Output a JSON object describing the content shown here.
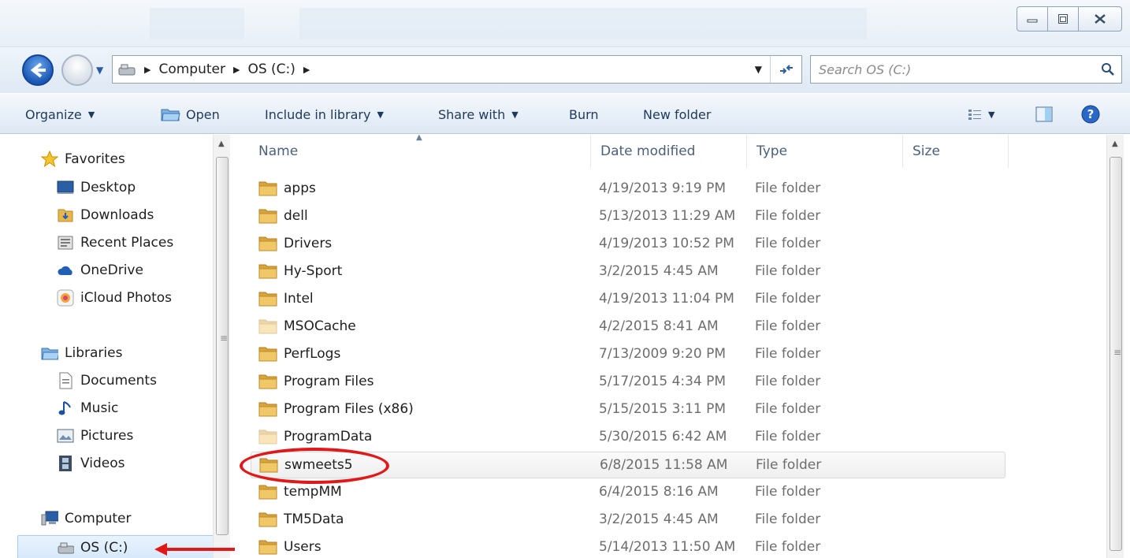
{
  "window": {
    "minimize_label": "",
    "maximize_label": "",
    "close_label": ""
  },
  "address": {
    "crumbs": [
      "Computer",
      "OS (C:)"
    ]
  },
  "search": {
    "placeholder": "Search OS (C:)"
  },
  "toolbar": {
    "organize": "Organize",
    "open": "Open",
    "include_in_library": "Include in library",
    "share_with": "Share with",
    "burn": "Burn",
    "new_folder": "New folder"
  },
  "nav": {
    "favorites": "Favorites",
    "desktop": "Desktop",
    "downloads": "Downloads",
    "recent_places": "Recent Places",
    "onedrive": "OneDrive",
    "icloud_photos": "iCloud Photos",
    "libraries": "Libraries",
    "documents": "Documents",
    "music": "Music",
    "pictures": "Pictures",
    "videos": "Videos",
    "computer": "Computer",
    "os_c": "OS (C:)"
  },
  "columns": {
    "name": "Name",
    "date_modified": "Date modified",
    "type": "Type",
    "size": "Size"
  },
  "files": [
    {
      "name": "apps",
      "date": "4/19/2013 9:19 PM",
      "type": "File folder"
    },
    {
      "name": "dell",
      "date": "5/13/2013 11:29 AM",
      "type": "File folder"
    },
    {
      "name": "Drivers",
      "date": "4/19/2013 10:52 PM",
      "type": "File folder"
    },
    {
      "name": "Hy-Sport",
      "date": "3/2/2015 4:45 AM",
      "type": "File folder"
    },
    {
      "name": "Intel",
      "date": "4/19/2013 11:04 PM",
      "type": "File folder"
    },
    {
      "name": "MSOCache",
      "date": "4/2/2015 8:41 AM",
      "type": "File folder"
    },
    {
      "name": "PerfLogs",
      "date": "7/13/2009 9:20 PM",
      "type": "File folder"
    },
    {
      "name": "Program Files",
      "date": "5/17/2015 4:34 PM",
      "type": "File folder"
    },
    {
      "name": "Program Files (x86)",
      "date": "5/15/2015 3:11 PM",
      "type": "File folder"
    },
    {
      "name": "ProgramData",
      "date": "5/30/2015 6:42 AM",
      "type": "File folder"
    },
    {
      "name": "swmeets5",
      "date": "6/8/2015 11:58 AM",
      "type": "File folder"
    },
    {
      "name": "tempMM",
      "date": "6/4/2015 8:16 AM",
      "type": "File folder"
    },
    {
      "name": "TM5Data",
      "date": "3/2/2015 4:45 AM",
      "type": "File folder"
    },
    {
      "name": "Users",
      "date": "5/14/2013 11:50 AM",
      "type": "File folder"
    }
  ],
  "colors": {
    "annotation_red": "#e01818",
    "folder_yellow": "#e8b64a",
    "selection_blue": "#d6e9fb"
  }
}
